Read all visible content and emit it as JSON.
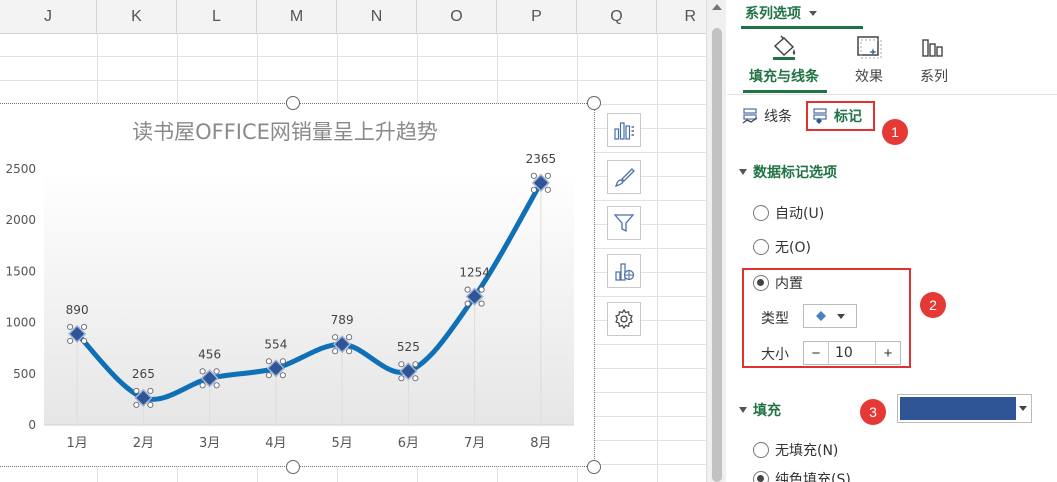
{
  "sheet": {
    "columns": [
      "J",
      "K",
      "L",
      "M",
      "N",
      "O",
      "P",
      "Q",
      "R"
    ]
  },
  "chart_data": {
    "type": "line",
    "title": "读书屋OFFICE网销量呈上升趋势",
    "categories": [
      "1月",
      "2月",
      "3月",
      "4月",
      "5月",
      "6月",
      "7月",
      "8月"
    ],
    "values": [
      890,
      265,
      456,
      554,
      789,
      525,
      1254,
      2365
    ],
    "data_labels": [
      "890",
      "265",
      "456",
      "554",
      "789",
      "525",
      "1254",
      "2365"
    ],
    "yticks": [
      "0",
      "500",
      "1000",
      "1500",
      "2000",
      "2500"
    ],
    "ylim": [
      0,
      2500
    ],
    "smooth": true,
    "marker": "diamond",
    "line_color": "#0f70b7",
    "marker_color": "#2f5597",
    "grid": false,
    "legend": "none"
  },
  "chart_tools": {
    "icons": [
      "chart-elements-icon",
      "chart-styles-icon",
      "chart-filters-icon",
      "chart-layout-icon",
      "chart-settings-icon"
    ]
  },
  "pane": {
    "series_tab": "系列选项",
    "categories": {
      "fill_line": "填充与线条",
      "effects": "效果",
      "series": "系列"
    },
    "subtabs": {
      "line": "线条",
      "marker": "标记"
    },
    "marker_options": {
      "heading": "数据标记选项",
      "auto": "自动(U)",
      "none": "无(O)",
      "builtin": "内置",
      "type_label": "类型",
      "size_label": "大小",
      "size_value": "10",
      "selected": "builtin"
    },
    "fill": {
      "heading": "填充",
      "no_fill": "无填充(N)",
      "solid_fill": "纯色填充(S)",
      "color": "#2f5597"
    },
    "badges": [
      "1",
      "2",
      "3"
    ]
  }
}
